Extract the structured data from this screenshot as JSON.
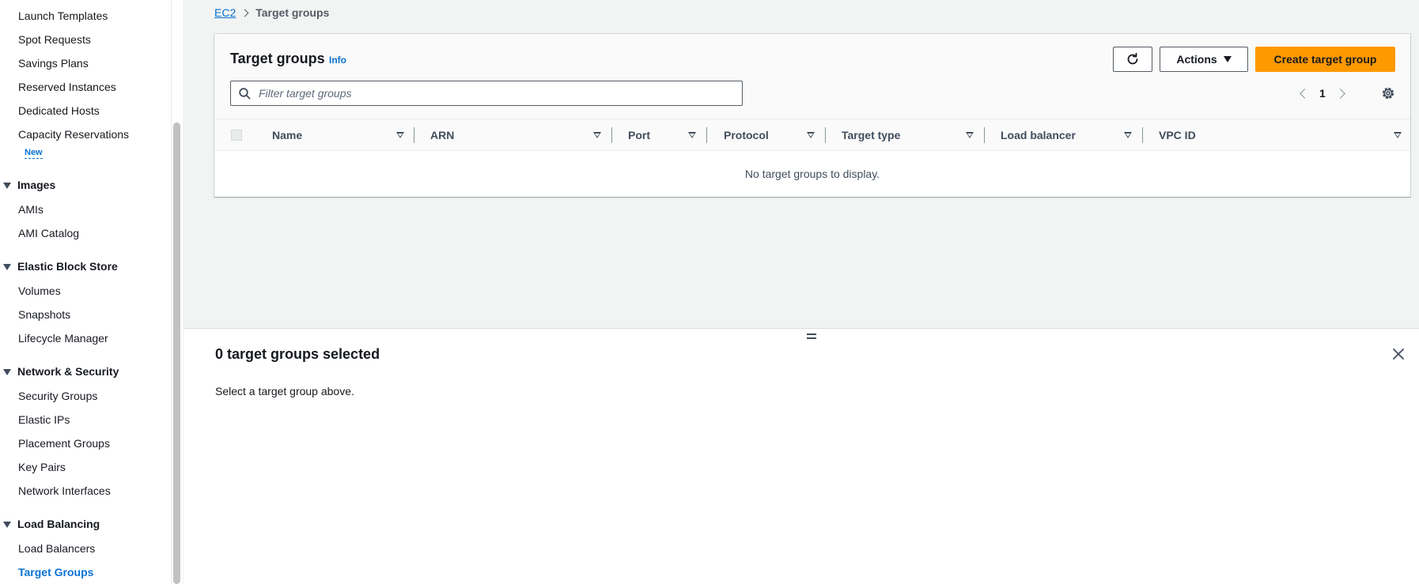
{
  "sidebar": {
    "items": [
      {
        "label": "Launch Templates"
      },
      {
        "label": "Spot Requests"
      },
      {
        "label": "Savings Plans"
      },
      {
        "label": "Reserved Instances"
      },
      {
        "label": "Dedicated Hosts"
      },
      {
        "label": "Capacity Reservations"
      }
    ],
    "new_badge": "New",
    "sections": {
      "images": {
        "label": "Images",
        "items": [
          "AMIs",
          "AMI Catalog"
        ]
      },
      "ebs": {
        "label": "Elastic Block Store",
        "items": [
          "Volumes",
          "Snapshots",
          "Lifecycle Manager"
        ]
      },
      "network": {
        "label": "Network & Security",
        "items": [
          "Security Groups",
          "Elastic IPs",
          "Placement Groups",
          "Key Pairs",
          "Network Interfaces"
        ]
      },
      "lb": {
        "label": "Load Balancing",
        "items": [
          "Load Balancers",
          "Target Groups"
        ]
      }
    },
    "active_item": "Target Groups"
  },
  "breadcrumb": {
    "root": "EC2",
    "current": "Target groups"
  },
  "table": {
    "title": "Target groups",
    "info": "Info",
    "actions_label": "Actions",
    "create_label": "Create target group",
    "filter_placeholder": "Filter target groups",
    "page": "1",
    "columns": [
      "Name",
      "ARN",
      "Port",
      "Protocol",
      "Target type",
      "Load balancer",
      "VPC ID"
    ],
    "empty_message": "No target groups to display."
  },
  "split_panel": {
    "title": "0 target groups selected",
    "message": "Select a target group above."
  },
  "colors": {
    "accent": "#0972d3",
    "primary_button": "#ff9900",
    "text": "#16191f"
  },
  "icons": [
    "refresh-icon",
    "search-icon",
    "settings-icon",
    "close-icon",
    "caret-down-icon",
    "chevron-left-icon",
    "chevron-right-icon",
    "sort-icon"
  ]
}
